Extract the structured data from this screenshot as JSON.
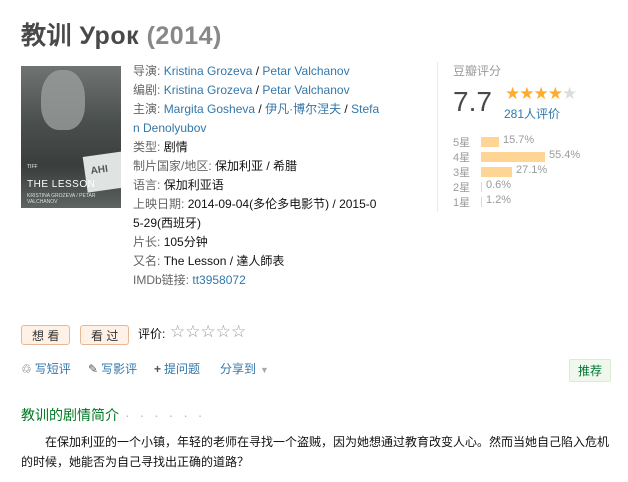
{
  "title": {
    "name": "教训 Урок",
    "year": "(2014)"
  },
  "poster": {
    "book_text": "АНІ",
    "title_text": "THE LESSON",
    "credit_text": "KRISTINA GROZEVA / PETAR VALCHANOV",
    "laurel_text": "TIFF"
  },
  "info": {
    "director_label": "导演:",
    "directors": [
      "Kristina Grozeva",
      "Petar Valchanov"
    ],
    "writer_label": "编剧:",
    "writers": [
      "Kristina Grozeva",
      "Petar Valchanov"
    ],
    "cast_label": "主演:",
    "cast": [
      "Margita Gosheva",
      "伊凡·博尔涅夫",
      "Stefa",
      "n Denolyubov"
    ],
    "genre_label": "类型:",
    "genre": "剧情",
    "country_label": "制片国家/地区:",
    "country": "保加利亚 / 希腊",
    "language_label": "语言:",
    "language": "保加利亚语",
    "release_label": "上映日期:",
    "release_line1": "2014-09-04(多伦多电影节) / 2015-0",
    "release_line2": "5-29(西班牙)",
    "runtime_label": "片长:",
    "runtime": "105分钟",
    "aka_label": "又名:",
    "aka": "The Lesson / 達人師表",
    "imdb_label": "IMDb链接:",
    "imdb": "tt3958072",
    "sep": " / "
  },
  "rating": {
    "label": "豆瓣评分",
    "score": "7.7",
    "stars_filled": 4,
    "stars_total": 5,
    "people": "281人评价",
    "distribution": [
      {
        "label": "5星",
        "pct": "15.7%",
        "value": 15.7
      },
      {
        "label": "4星",
        "pct": "55.4%",
        "value": 55.4
      },
      {
        "label": "3星",
        "pct": "27.1%",
        "value": 27.1
      },
      {
        "label": "2星",
        "pct": "0.6%",
        "value": 0.6
      },
      {
        "label": "1星",
        "pct": "1.2%",
        "value": 1.2
      }
    ]
  },
  "actions": {
    "wish": "想 看",
    "seen": "看 过",
    "my_rating_label": "评价:",
    "my_stars": "☆☆☆☆☆",
    "short_review": "写短评",
    "review": "写影评",
    "question": "提问题",
    "share": "分享到",
    "recommend": "推荐"
  },
  "summary": {
    "title": "教训的剧情简介",
    "dots": "· · · · · ·",
    "text": "在保加利亚的一个小镇，年轻的老师在寻找一个盗贼，因为她想通过教育改变人心。然而当她自己陷入危机的时候，她能否为自己寻找出正确的道路？"
  },
  "colors": {
    "link": "#3377aa",
    "star": "#ffac2d",
    "bar": "#ffd596",
    "section": "#007722",
    "button_bg": "#fff1e5"
  }
}
